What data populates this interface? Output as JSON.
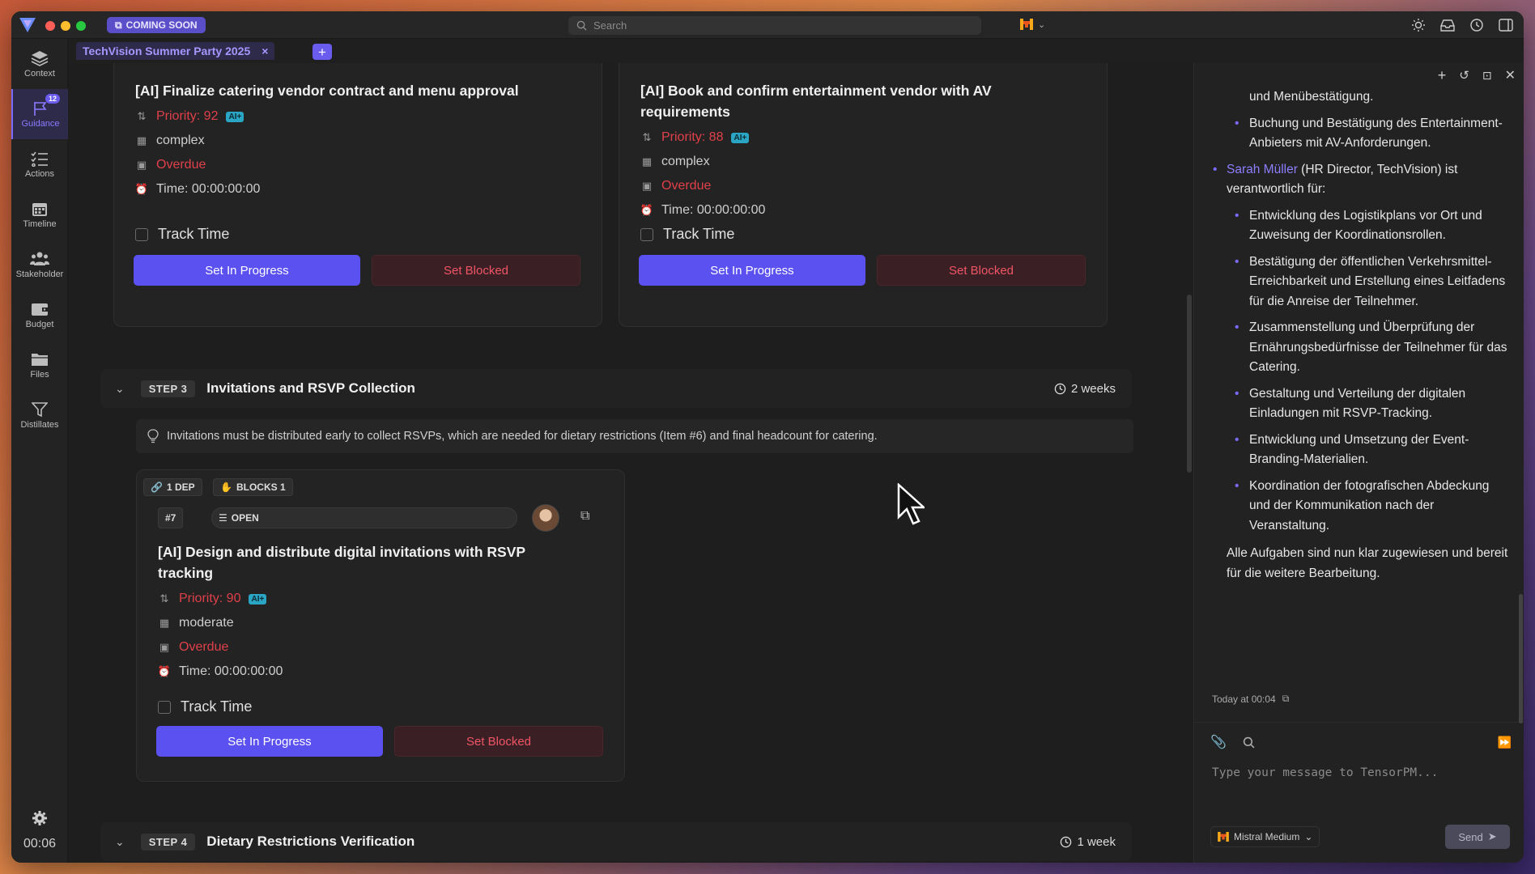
{
  "titlebar": {
    "coming_soon": "COMING SOON",
    "search_placeholder": "Search"
  },
  "rail": {
    "items": [
      {
        "label": "Context"
      },
      {
        "label": "Guidance",
        "badge": "12"
      },
      {
        "label": "Actions"
      },
      {
        "label": "Timeline"
      },
      {
        "label": "Stakeholder"
      },
      {
        "label": "Budget"
      },
      {
        "label": "Files"
      },
      {
        "label": "Distillates"
      }
    ],
    "time": "00:06"
  },
  "tab": {
    "label": "TechVision Summer Party 2025",
    "close": "×",
    "add": "+"
  },
  "cards": [
    {
      "title": "[AI] Finalize catering vendor contract and menu approval",
      "priority": "Priority: 92",
      "ai": "AI+",
      "complexity": "complex",
      "status": "Overdue",
      "time": "Time: 00:00:00:00"
    },
    {
      "title": "[AI] Book and confirm entertainment vendor with AV requirements",
      "priority": "Priority: 88",
      "ai": "AI+",
      "complexity": "complex",
      "status": "Overdue",
      "time": "Time: 00:00:00:00"
    },
    {
      "deps": "1 DEP",
      "blocks": "BLOCKS 1",
      "id": "#7",
      "state": "OPEN",
      "title": "[AI] Design and distribute digital invitations with RSVP tracking",
      "priority": "Priority: 90",
      "ai": "AI+",
      "complexity": "moderate",
      "status": "Overdue",
      "time": "Time: 00:00:00:00"
    }
  ],
  "common": {
    "track_time": "Track Time",
    "set_in_progress": "Set In Progress",
    "set_blocked": "Set Blocked"
  },
  "steps": [
    {
      "pill": "STEP 3",
      "title": "Invitations and RSVP Collection",
      "duration": "2 weeks"
    },
    {
      "pill": "STEP 4",
      "title": "Dietary Restrictions Verification",
      "duration": "1 week"
    }
  ],
  "hint": "Invitations must be distributed early to collect RSVPs, which are needed for dietary restrictions (Item #6) and final headcount for catering.",
  "chat": {
    "line_top": "und Menübestätigung.",
    "sub1": "Buchung und Bestätigung des Entertainment-Anbieters mit AV-Anforderungen.",
    "person_name": "Sarah Müller",
    "person_role": " (HR Director, TechVision) ist verantwortlich für:",
    "items": [
      "Entwicklung des Logistikplans vor Ort und Zuweisung der Koordinationsrollen.",
      "Bestätigung der öffentlichen Verkehrsmittel-Erreichbarkeit und Erstellung eines Leitfadens für die Anreise der Teilnehmer.",
      "Zusammenstellung und Überprüfung der Ernährungsbedürfnisse der Teilnehmer für das Catering.",
      "Gestaltung und Verteilung der digitalen Einladungen mit RSVP-Tracking.",
      "Entwicklung und Umsetzung der Event-Branding-Materialien.",
      "Koordination der fotografischen Abdeckung und der Kommunikation nach der Veranstaltung."
    ],
    "closing": "Alle Aufgaben sind nun klar zugewiesen und bereit für die weitere Bearbeitung.",
    "timestamp": "Today at 00:04"
  },
  "composer": {
    "placeholder": "Type your message to TensorPM...",
    "model": "Mistral Medium",
    "send": "Send"
  },
  "colors": {
    "accent": "#5b50f0",
    "danger": "#e0404a",
    "ai_tag": "#2aa6c4"
  }
}
